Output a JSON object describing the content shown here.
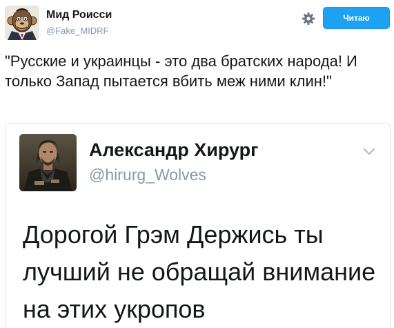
{
  "tweet": {
    "author": {
      "display_name": "Мид Роисси",
      "screen_name": "@Fake_MIDRF",
      "avatar_icon": "monkey-avatar"
    },
    "settings_icon": "gear-icon",
    "follow_button_label": "Читаю",
    "text": "\"Русские и украинцы - это два братских народа! И только Запад пытается вбить меж ними клин!\""
  },
  "quoted_tweet": {
    "author": {
      "display_name": "Александр Хирург",
      "screen_name": "@hirurg_Wolves",
      "avatar_icon": "biker-avatar"
    },
    "menu_icon": "chevron-down-icon",
    "text": "Дорогой Грэм Держись ты лучший не обращай внимание на этих укропов"
  },
  "colors": {
    "accent": "#1da1f2",
    "secondary_text": "#8899a6",
    "border": "#e1e8ed"
  }
}
